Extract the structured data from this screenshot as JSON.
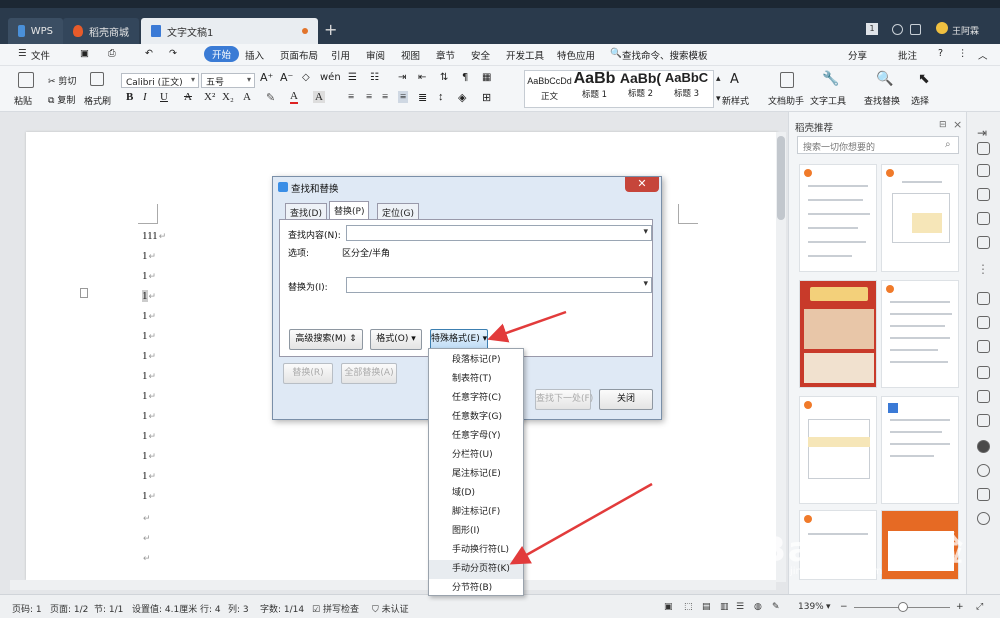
{
  "titlebar": {
    "tabs": [
      {
        "label": "WPS"
      },
      {
        "label": "稻壳商城"
      },
      {
        "label": "文字文稿1"
      }
    ],
    "page_counter": "1",
    "user_name": "王阿霖"
  },
  "menubar": {
    "file": "文件",
    "items": [
      "开始",
      "插入",
      "页面布局",
      "引用",
      "审阅",
      "视图",
      "章节",
      "安全",
      "开发工具",
      "特色应用"
    ],
    "search": "查找命令、搜索模板",
    "share": "分享",
    "comment": "批注"
  },
  "ribbon": {
    "paste": "粘贴",
    "cut": "剪切",
    "copy": "复制",
    "format_painter": "格式刷",
    "font_name": "Calibri (正文)",
    "font_size": "五号",
    "styles": [
      {
        "sample": "AaBbCcDd",
        "name": "正文"
      },
      {
        "sample": "AaBb",
        "name": "标题 1"
      },
      {
        "sample": "AaBb(",
        "name": "标题 2"
      },
      {
        "sample": "AaBbC",
        "name": "标题 3"
      }
    ],
    "new_style": "新样式",
    "doc_assistant": "文档助手",
    "text_tools": "文字工具",
    "find_replace": "查找替换",
    "select": "选择"
  },
  "document": {
    "lines": [
      "111",
      "1",
      "1",
      "1",
      "1",
      "1",
      "1",
      "1",
      "1",
      "1",
      "1",
      "1",
      "1",
      "1"
    ]
  },
  "right_panel": {
    "title": "稻壳推荐",
    "search_placeholder": "搜索一切你想要的"
  },
  "dialog": {
    "title": "查找和替换",
    "tabs": [
      "查找(D)",
      "替换(P)",
      "定位(G)"
    ],
    "find_label": "查找内容(N):",
    "options_label": "选项:",
    "options_value": "区分全/半角",
    "replace_label": "替换为(I):",
    "advanced_search": "高级搜索(M)",
    "format": "格式(O)",
    "special_format": "特殊格式(E)",
    "replace_btn": "替换(R)",
    "replace_all_btn": "全部替换(A)",
    "find_next_btn": "查找下一处(F)",
    "close_btn": "关闭"
  },
  "special_menu": {
    "items": [
      "段落标记(P)",
      "制表符(T)",
      "任意字符(C)",
      "任意数字(G)",
      "任意字母(Y)",
      "分栏符(U)",
      "尾注标记(E)",
      "域(D)",
      "脚注标记(F)",
      "图形(I)",
      "手动换行符(L)",
      "手动分页符(K)",
      "分节符(B)"
    ],
    "highlighted": "手动分页符(K)"
  },
  "statusbar": {
    "page_num": "页码: 1",
    "pages": "页面: 1/2",
    "section": "节: 1/1",
    "position": "设置值: 4.1厘米",
    "row": "行: 4",
    "col": "列: 3",
    "word_count": "字数: 1/14",
    "spell_check": "拼写检查",
    "certification": "未认证",
    "zoom": "139%"
  },
  "watermark": {
    "text": "Baidu 经验",
    "sub": "jingyan.baidu.com"
  },
  "colors": {
    "accent": "#3a7bd5",
    "titlebar": "#2a3a4c",
    "arrow": "#e23b3b"
  }
}
